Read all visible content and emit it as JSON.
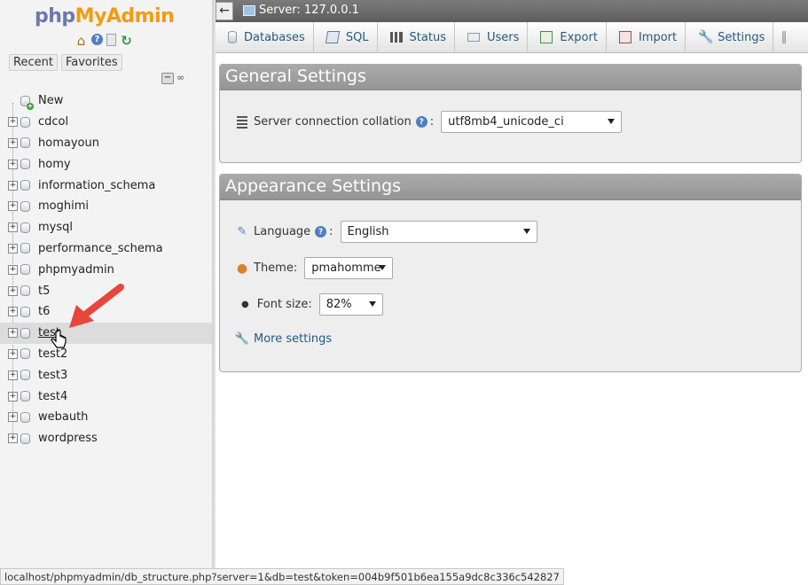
{
  "app": {
    "logo_php": "php",
    "logo_admin": "MyAdmin"
  },
  "sidebar": {
    "recent_label": "Recent",
    "favorites_label": "Favorites",
    "quick_icons": [
      "home-icon",
      "help-icon",
      "docs-icon",
      "reload-icon"
    ],
    "new_label": "New",
    "databases": [
      "cdcol",
      "homayoun",
      "homy",
      "information_schema",
      "moghimi",
      "mysql",
      "performance_schema",
      "phpmyadmin",
      "t5",
      "t6",
      "test",
      "test2",
      "test3",
      "test4",
      "webauth",
      "wordpress"
    ],
    "hovered_database": "test"
  },
  "topbar": {
    "back_symbol": "←",
    "server_label": "Server: 127.0.0.1"
  },
  "tabs": [
    {
      "label": "Databases",
      "icon": "database-icon"
    },
    {
      "label": "SQL",
      "icon": "sql-icon"
    },
    {
      "label": "Status",
      "icon": "status-icon"
    },
    {
      "label": "Users",
      "icon": "users-icon"
    },
    {
      "label": "Export",
      "icon": "export-icon"
    },
    {
      "label": "Import",
      "icon": "import-icon"
    },
    {
      "label": "Settings",
      "icon": "settings-icon"
    }
  ],
  "general_settings": {
    "title": "General Settings",
    "collation_label": "Server connection collation",
    "collation_value": "utf8mb4_unicode_ci"
  },
  "appearance_settings": {
    "title": "Appearance Settings",
    "language_label": "Language",
    "language_value": "English",
    "theme_label": "Theme:",
    "theme_value": "pmahomme",
    "font_size_label": "Font size:",
    "font_size_value": "82%",
    "more_settings_label": "More settings"
  },
  "statusbar": {
    "url": "localhost/phpmyadmin/db_structure.php?server=1&db=test&token=004b9f501b6ea155a9dc8c336c542827"
  },
  "colors": {
    "logo_php": "#6c78af",
    "logo_admin": "#f29c11",
    "link": "#235a81",
    "panel_header": "#a0a0a0",
    "arrow": "#e8453c"
  }
}
